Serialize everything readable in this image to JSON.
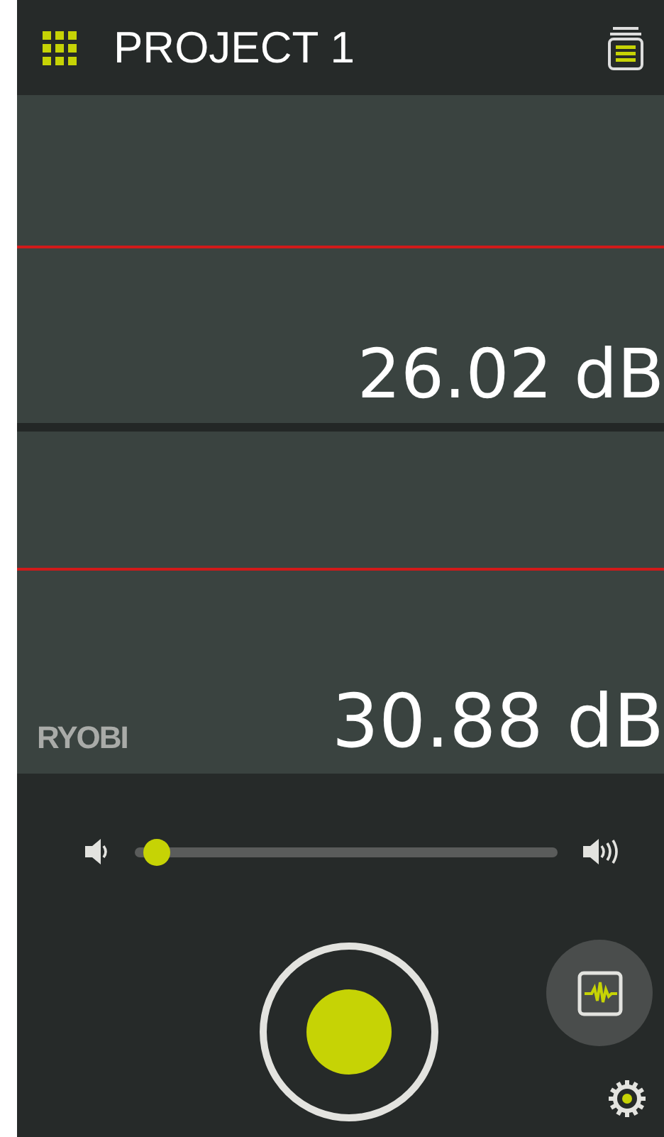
{
  "header": {
    "title": "PROJECT 1"
  },
  "channels": [
    {
      "reading": "26.02 dB"
    },
    {
      "reading": "30.88 dB",
      "logo": "RYOBI"
    }
  ],
  "volume": {
    "level": 0.05
  }
}
